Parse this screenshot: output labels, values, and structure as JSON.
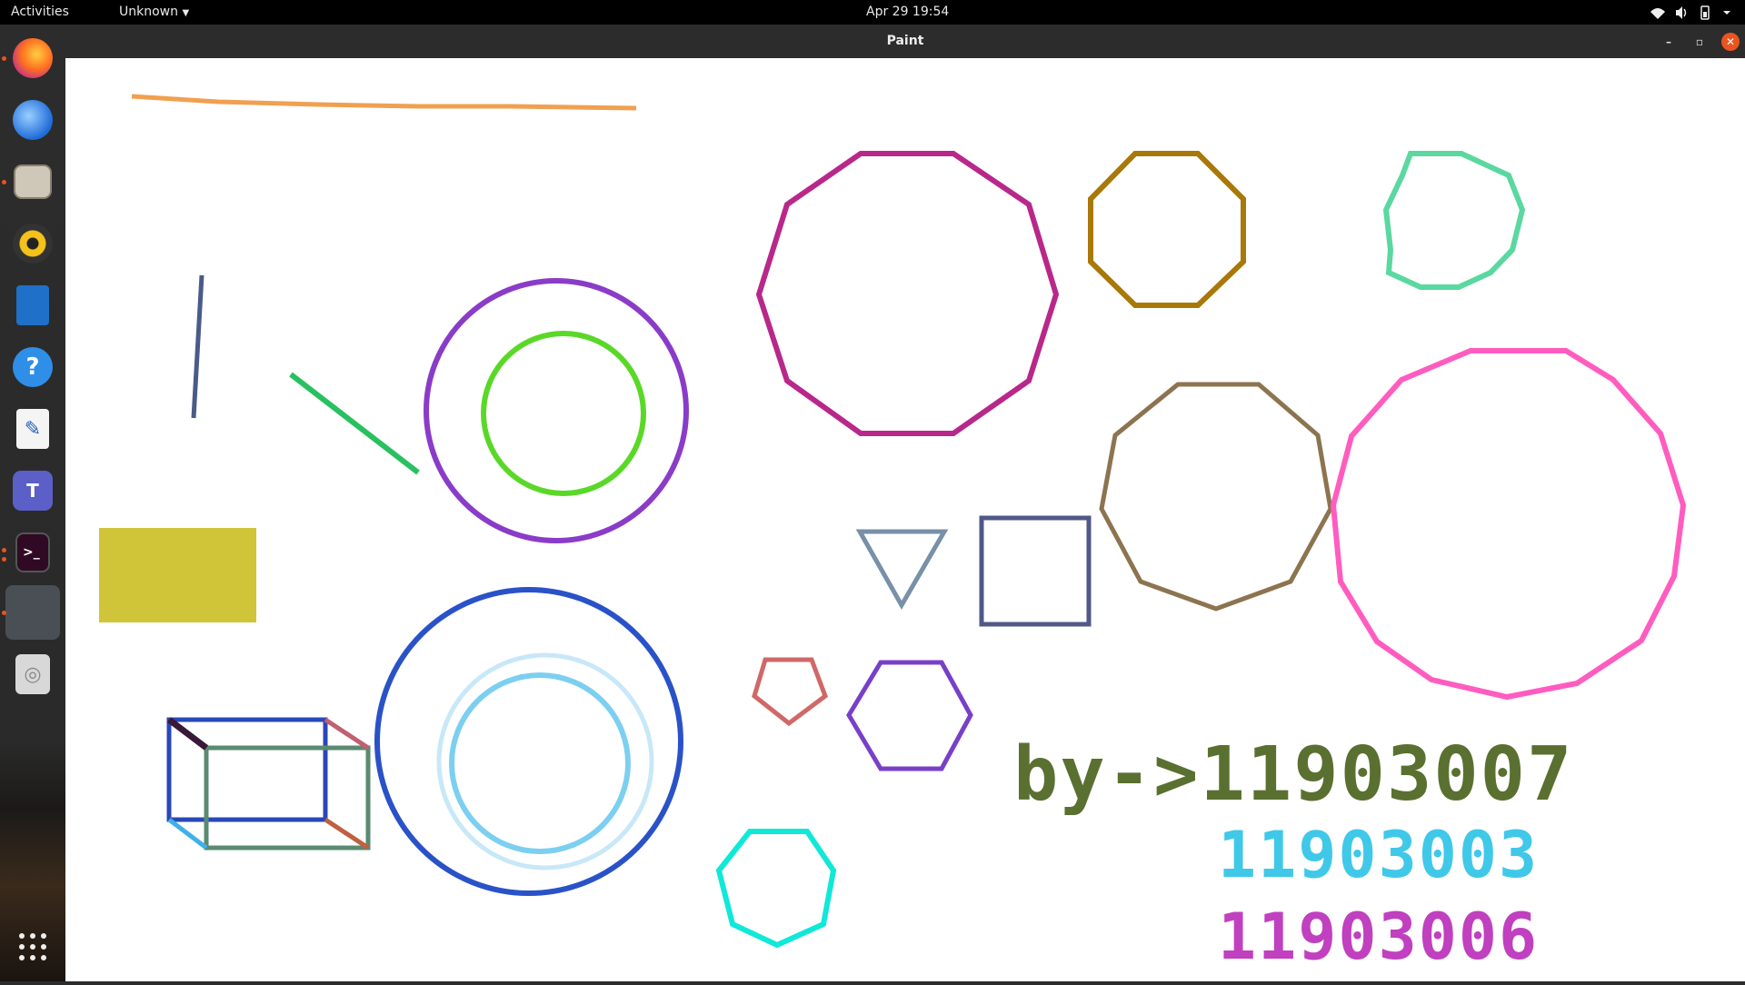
{
  "topbar": {
    "activities": "Activities",
    "app_menu": "Unknown",
    "clock": "Apr 29  19:54"
  },
  "window": {
    "title": "Paint"
  },
  "dock": {
    "items": [
      {
        "name": "firefox-icon",
        "running": true
      },
      {
        "name": "thunderbird-icon",
        "running": false
      },
      {
        "name": "files-icon",
        "running": true
      },
      {
        "name": "rhythmbox-icon",
        "running": false
      },
      {
        "name": "writer-icon",
        "running": false
      },
      {
        "name": "help-icon",
        "running": false
      },
      {
        "name": "text-editor-icon",
        "running": false
      },
      {
        "name": "teams-icon",
        "running": false
      },
      {
        "name": "terminal-icon",
        "running": true
      },
      {
        "name": "paint-icon",
        "running": true
      },
      {
        "name": "disc-icon",
        "running": false
      },
      {
        "name": "show-apps-icon",
        "running": false
      }
    ]
  },
  "drawing": {
    "text_line1": "by->11903007",
    "text_line2": "11903003",
    "text_line3": "11903006",
    "colors": {
      "orange_line": "#f0a050",
      "purple_circle": "#8a3cc8",
      "green_circle": "#5ad828",
      "magenta_decagon": "#b8288a",
      "brown_octagon": "#a87808",
      "mint_polygon": "#5ad8a0",
      "pink_polygon": "#ff5cc0",
      "khaki_polygon": "#8c7450",
      "yellow_rect": "#d0c438",
      "blue_circle": "#2a52c8",
      "sky_circle": "#7ccff0"
    }
  }
}
